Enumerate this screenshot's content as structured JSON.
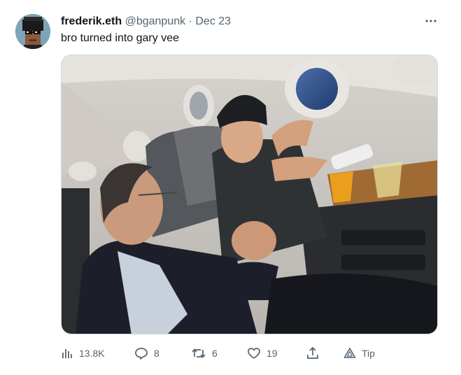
{
  "tweet": {
    "author": {
      "display_name": "frederik.eth",
      "handle": "@bganpunk",
      "separator": "·",
      "date": "Dec 23"
    },
    "text": "bro turned into gary vee",
    "more_icon": "more-dots-icon",
    "media": {
      "description_icon": "photo-airplane-cabin"
    },
    "actions": {
      "views": {
        "icon": "analytics-icon",
        "count": "13.8K"
      },
      "reply": {
        "icon": "reply-icon",
        "count": "8"
      },
      "retweet": {
        "icon": "retweet-icon",
        "count": "6"
      },
      "like": {
        "icon": "heart-icon",
        "count": "19"
      },
      "share": {
        "icon": "share-icon"
      },
      "tip": {
        "icon": "tip-icon",
        "label": "Tip"
      }
    }
  },
  "colors": {
    "text_primary": "#0f1419",
    "text_secondary": "#536471",
    "border": "#cfd9de"
  }
}
